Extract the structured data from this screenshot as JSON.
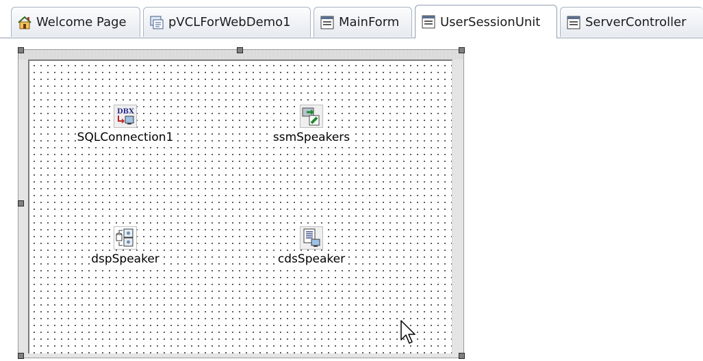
{
  "tabs": [
    {
      "label": "Welcome Page",
      "icon": "home-icon",
      "active": false
    },
    {
      "label": "pVCLForWebDemo1",
      "icon": "project-icon",
      "active": false
    },
    {
      "label": "MainForm",
      "icon": "form-icon",
      "active": false
    },
    {
      "label": "UserSessionUnit",
      "icon": "form-icon",
      "active": true
    },
    {
      "label": "ServerController",
      "icon": "form-icon",
      "active": false
    }
  ],
  "designer": {
    "components": [
      {
        "name": "SQLConnection1",
        "icon": "dbx-connection-icon"
      },
      {
        "name": "ssmSpeakers",
        "icon": "shared-connection-icon"
      },
      {
        "name": "dspSpeaker",
        "icon": "dataset-provider-icon"
      },
      {
        "name": "cdsSpeaker",
        "icon": "client-dataset-icon"
      }
    ],
    "dbx_text": "DBX"
  },
  "colors": {
    "tab_border": "#a9b3c4",
    "form_frame": "#e4e4e4",
    "grid_dot": "#404040",
    "handle": "#808080"
  }
}
